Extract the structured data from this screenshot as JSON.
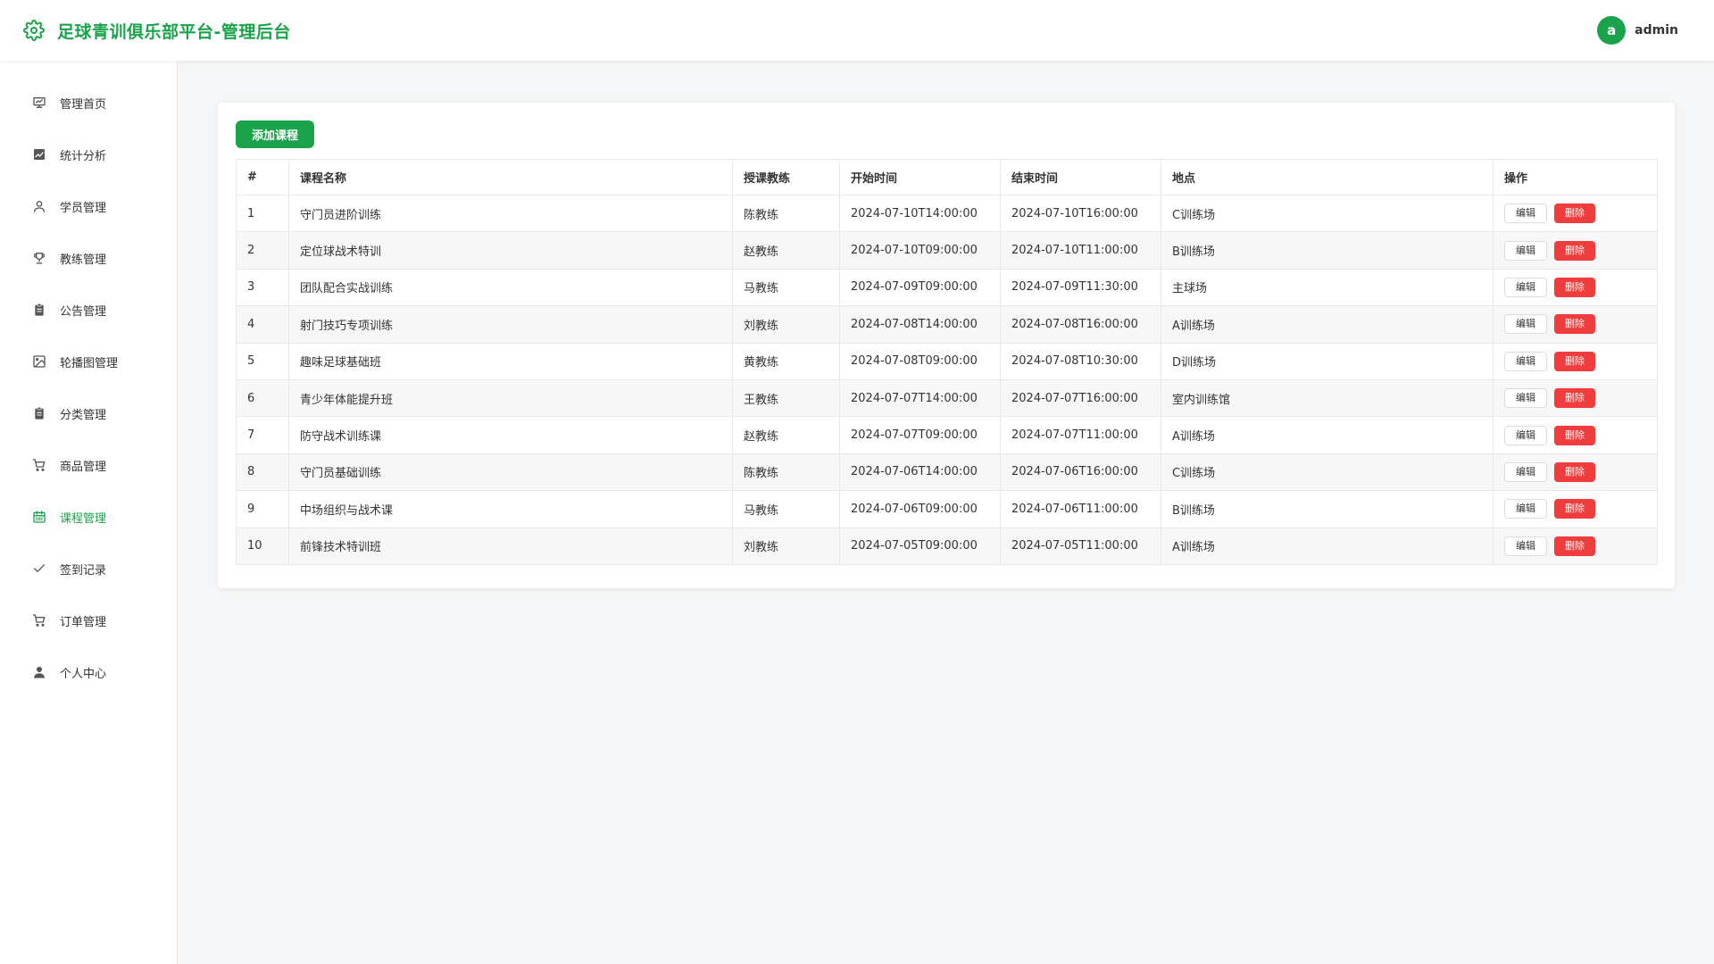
{
  "app": {
    "title": "足球青训俱乐部平台-管理后台",
    "logo_icon": "gear-icon",
    "brand_color": "#1aa34a"
  },
  "user": {
    "avatar_letter": "a",
    "name": "admin"
  },
  "sidebar": {
    "items": [
      {
        "label": "管理首页",
        "icon": "presentation-icon",
        "active": false
      },
      {
        "label": "统计分析",
        "icon": "chart-icon",
        "active": false
      },
      {
        "label": "学员管理",
        "icon": "user-icon",
        "active": false
      },
      {
        "label": "教练管理",
        "icon": "trophy-icon",
        "active": false
      },
      {
        "label": "公告管理",
        "icon": "clipboard-icon",
        "active": false
      },
      {
        "label": "轮播图管理",
        "icon": "image-icon",
        "active": false
      },
      {
        "label": "分类管理",
        "icon": "clipboard-icon",
        "active": false
      },
      {
        "label": "商品管理",
        "icon": "cart-icon",
        "active": false
      },
      {
        "label": "课程管理",
        "icon": "calendar-icon",
        "active": true
      },
      {
        "label": "签到记录",
        "icon": "check-icon",
        "active": false
      },
      {
        "label": "订单管理",
        "icon": "cart-icon",
        "active": false
      },
      {
        "label": "个人中心",
        "icon": "person-icon",
        "active": false
      }
    ]
  },
  "toolbar": {
    "add_label": "添加课程"
  },
  "table": {
    "columns": [
      "#",
      "课程名称",
      "授课教练",
      "开始时间",
      "结束时间",
      "地点",
      "操作"
    ],
    "edit_label": "编辑",
    "delete_label": "删除",
    "rows": [
      {
        "id": "1",
        "name": "守门员进阶训练",
        "coach": "陈教练",
        "start": "2024-07-10T14:00:00",
        "end": "2024-07-10T16:00:00",
        "location": "C训练场"
      },
      {
        "id": "2",
        "name": "定位球战术特训",
        "coach": "赵教练",
        "start": "2024-07-10T09:00:00",
        "end": "2024-07-10T11:00:00",
        "location": "B训练场"
      },
      {
        "id": "3",
        "name": "团队配合实战训练",
        "coach": "马教练",
        "start": "2024-07-09T09:00:00",
        "end": "2024-07-09T11:30:00",
        "location": "主球场"
      },
      {
        "id": "4",
        "name": "射门技巧专项训练",
        "coach": "刘教练",
        "start": "2024-07-08T14:00:00",
        "end": "2024-07-08T16:00:00",
        "location": "A训练场"
      },
      {
        "id": "5",
        "name": "趣味足球基础班",
        "coach": "黄教练",
        "start": "2024-07-08T09:00:00",
        "end": "2024-07-08T10:30:00",
        "location": "D训练场"
      },
      {
        "id": "6",
        "name": "青少年体能提升班",
        "coach": "王教练",
        "start": "2024-07-07T14:00:00",
        "end": "2024-07-07T16:00:00",
        "location": "室内训练馆"
      },
      {
        "id": "7",
        "name": "防守战术训练课",
        "coach": "赵教练",
        "start": "2024-07-07T09:00:00",
        "end": "2024-07-07T11:00:00",
        "location": "A训练场"
      },
      {
        "id": "8",
        "name": "守门员基础训练",
        "coach": "陈教练",
        "start": "2024-07-06T14:00:00",
        "end": "2024-07-06T16:00:00",
        "location": "C训练场"
      },
      {
        "id": "9",
        "name": "中场组织与战术课",
        "coach": "马教练",
        "start": "2024-07-06T09:00:00",
        "end": "2024-07-06T11:00:00",
        "location": "B训练场"
      },
      {
        "id": "10",
        "name": "前锋技术特训班",
        "coach": "刘教练",
        "start": "2024-07-05T09:00:00",
        "end": "2024-07-05T11:00:00",
        "location": "A训练场"
      }
    ]
  }
}
